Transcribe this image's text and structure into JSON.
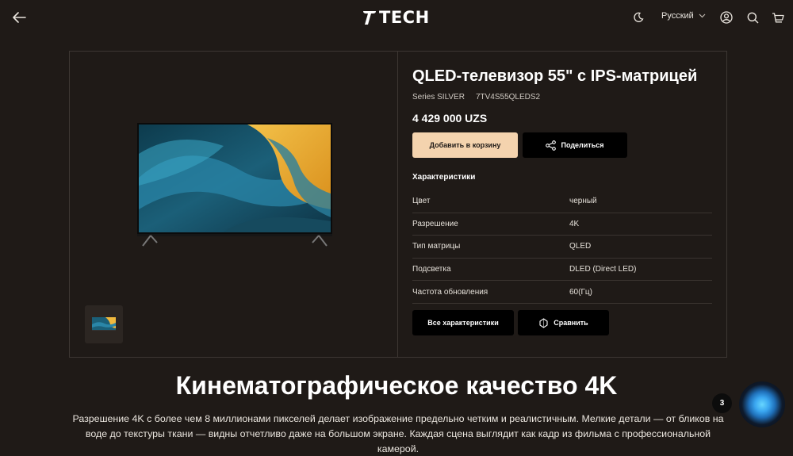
{
  "header": {
    "logo_text": "TECH",
    "language": "Русский"
  },
  "product": {
    "title": "QLED-телевизор 55\" с IPS-матрицей",
    "series": "Series SILVER",
    "sku": "7TV4S55QLEDS2",
    "price": "4 429 000 UZS",
    "add_to_cart_label": "Добавить в корзину",
    "share_label": "Поделиться",
    "specs_title": "Характеристики",
    "specs": [
      {
        "key": "Цвет",
        "value": "черный"
      },
      {
        "key": "Разрешение",
        "value": "4K"
      },
      {
        "key": "Тип матрицы",
        "value": "QLED"
      },
      {
        "key": "Подсветка",
        "value": "DLED (Direct LED)"
      },
      {
        "key": "Частота обновления",
        "value": "60(Гц)"
      }
    ],
    "all_specs_label": "Все характеристики",
    "compare_label": "Сравнить"
  },
  "section": {
    "title": "Кинематографическое качество 4K",
    "text": "Разрешение 4K с более чем 8 миллионами пикселей делает изображение предельно четким и реалистичным. Мелкие детали — от бликов на воде до текстуры ткани — видны отчетливо даже на большом экране. Каждая сцена выглядит как кадр из фильма с профессиональной камерой."
  },
  "chat": {
    "badge_count": "3"
  },
  "colors": {
    "background": "#1f1a17",
    "accent_button": "#f4d3ae",
    "dark_button": "#000000"
  },
  "icons": [
    "back-arrow-icon",
    "logo-icon",
    "moon-icon",
    "chevron-down-icon",
    "user-icon",
    "search-icon",
    "cart-icon",
    "share-icon",
    "compare-icon",
    "chat-orb-icon"
  ]
}
